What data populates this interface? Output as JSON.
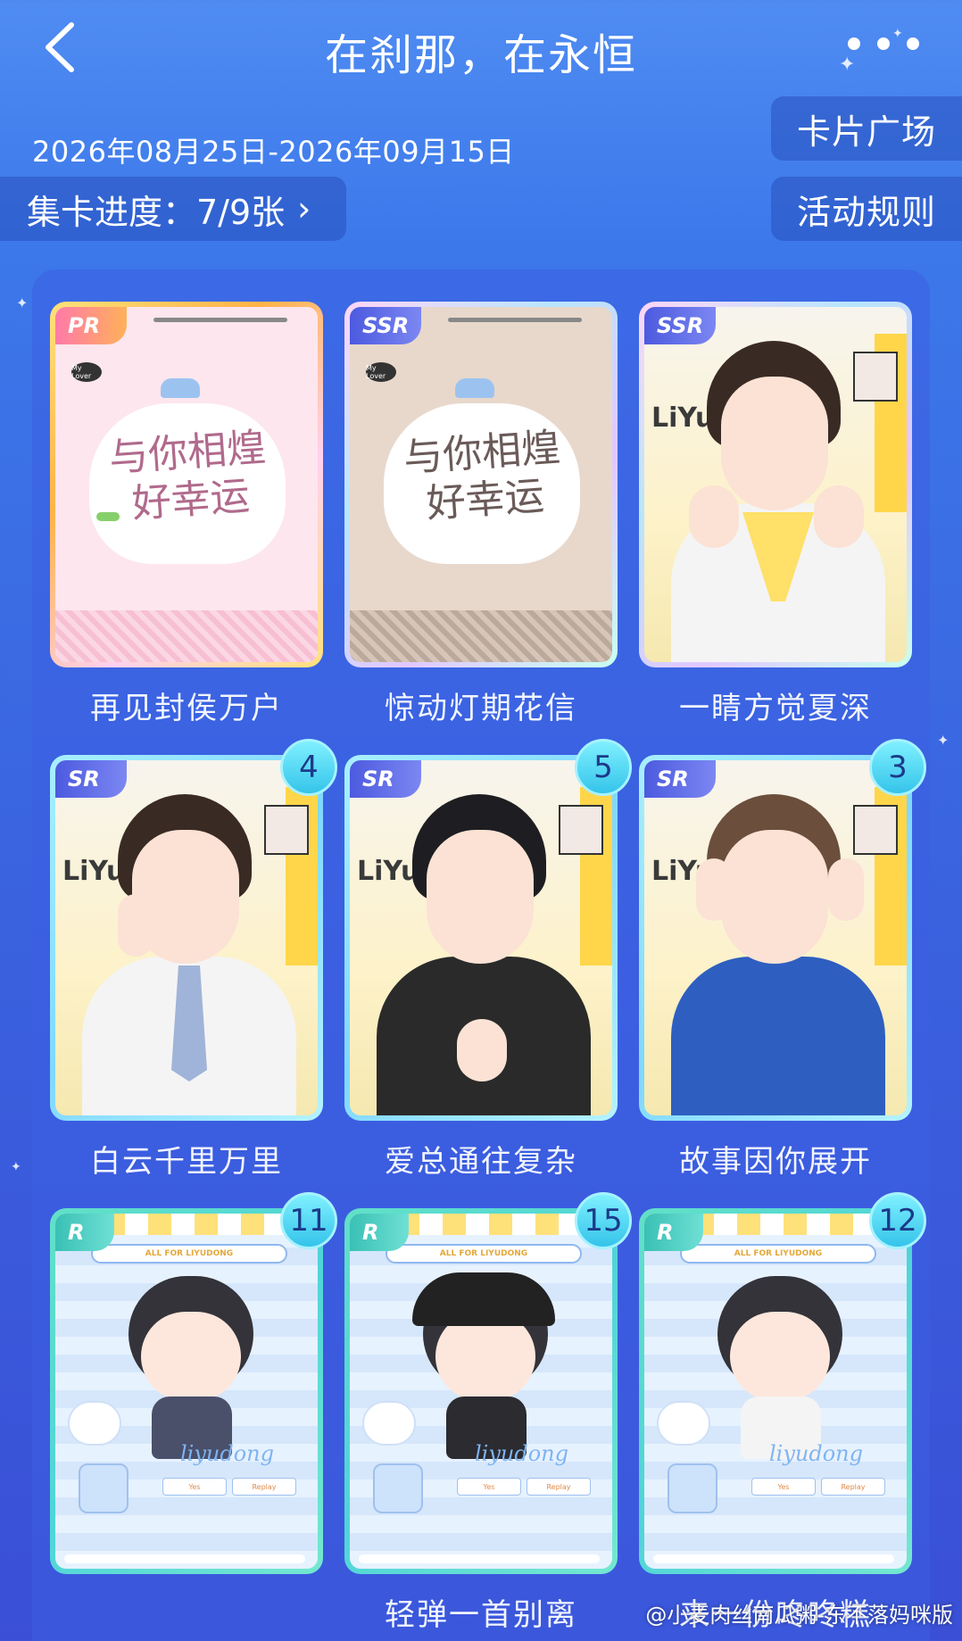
{
  "header": {
    "title": "在刹那，在永恒",
    "back_icon": "chevron-left-icon",
    "more_icon": "more-dots-icon"
  },
  "event": {
    "date_range": "2026年08月25日-2026年09月15日",
    "progress_label": "集卡进度：7/9张",
    "progress_collected": 7,
    "progress_total": 9
  },
  "actions": {
    "card_square": "卡片广场",
    "rules": "活动规则"
  },
  "cards": [
    {
      "name": "再见封侯万户",
      "rarity": "PR",
      "count": null
    },
    {
      "name": "惊动灯期花信",
      "rarity": "SSR",
      "count": null
    },
    {
      "name": "一睛方觉夏深",
      "rarity": "SSR",
      "count": null
    },
    {
      "name": "白云千里万里",
      "rarity": "SR",
      "count": "4"
    },
    {
      "name": "爱总通往复杂",
      "rarity": "SR",
      "count": "5"
    },
    {
      "name": "故事因你展开",
      "rarity": "SR",
      "count": "3"
    },
    {
      "name": "",
      "rarity": "R",
      "count": "11"
    },
    {
      "name": "轻弹一首别离",
      "rarity": "R",
      "count": "15"
    },
    {
      "name": "来一份咚咚糕",
      "rarity": "R",
      "count": "12"
    }
  ],
  "card_art": {
    "script_text": "与你相煌 好幸运",
    "my_lover": "My Lover",
    "liyu_text": "LiYu DON",
    "chibi_banner": "ALL FOR LIYUDONG",
    "chibi_signature": "liyudong",
    "chibi_yes": "Yes",
    "chibi_replay": "Replay"
  },
  "watermark": "@小麦肉丝南瓜粥-东不落妈咪版",
  "colors": {
    "background": "#3c6fe6",
    "accent_badge": "#35c4ea"
  }
}
